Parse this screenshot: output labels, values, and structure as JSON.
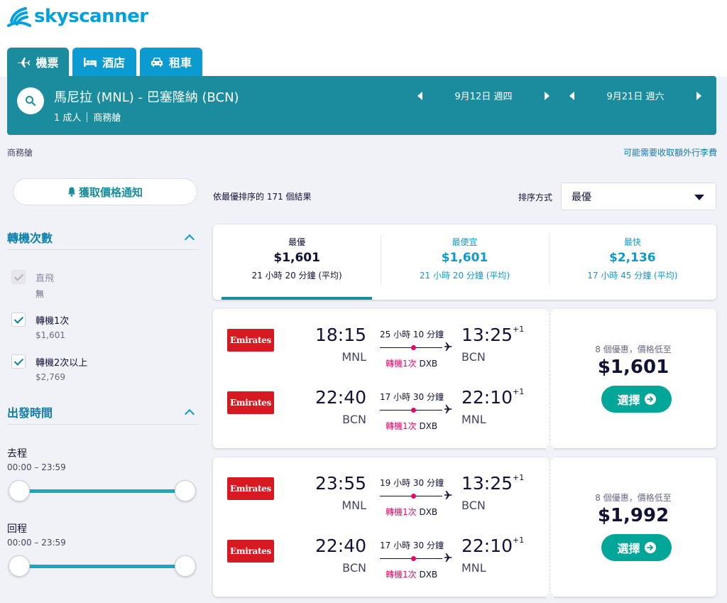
{
  "brand": {
    "name": "skyscanner"
  },
  "tabs": [
    {
      "label": "機票",
      "icon": "plane-icon"
    },
    {
      "label": "酒店",
      "icon": "bed-icon"
    },
    {
      "label": "租車",
      "icon": "car-icon"
    }
  ],
  "search": {
    "route": "馬尼拉 (MNL) - 巴塞隆納 (BCN)",
    "passengers": "1 成人",
    "cabin": "商務艙",
    "depart_date": "9月12日 週四",
    "return_date": "9月21日 週六"
  },
  "info": {
    "cabin_label": "商務艙",
    "baggage_note": "可能需要收取額外行李費"
  },
  "alert_button": "獲取價格通知",
  "filters": {
    "stops_title": "轉機次數",
    "stops": [
      {
        "label": "直飛",
        "sub": "無",
        "checked": true,
        "disabled": true
      },
      {
        "label": "轉機1次",
        "sub": "$1,601",
        "checked": true,
        "disabled": false
      },
      {
        "label": "轉機2次以上",
        "sub": "$2,769",
        "checked": true,
        "disabled": false
      }
    ],
    "times_title": "出發時間",
    "outbound_label": "去程",
    "outbound_range": "00:00 – 23:59",
    "return_label": "回程",
    "return_range": "00:00 – 23:59"
  },
  "results": {
    "count_text": "依最優排序的 171 個結果",
    "sort_label": "排序方式",
    "sort_value": "最優"
  },
  "sort_tabs": [
    {
      "title": "最優",
      "price": "$1,601",
      "duration": "21 小時 20 分鐘 (平均)"
    },
    {
      "title": "最便宜",
      "price": "$1,601",
      "duration": "21 小時 20 分鐘 (平均)"
    },
    {
      "title": "最快",
      "price": "$2,136",
      "duration": "17 小時 45 分鐘 (平均)"
    }
  ],
  "cards": [
    {
      "legs": [
        {
          "airline": "Emirates",
          "dep_time": "18:15",
          "dep_code": "MNL",
          "duration": "25 小時 10 分鐘",
          "stops": "轉機1次",
          "via": "DXB",
          "arr_time": "13:25",
          "day_offset": "+1",
          "arr_code": "BCN"
        },
        {
          "airline": "Emirates",
          "dep_time": "22:40",
          "dep_code": "BCN",
          "duration": "17 小時 30 分鐘",
          "stops": "轉機1次",
          "via": "DXB",
          "arr_time": "22:10",
          "day_offset": "+1",
          "arr_code": "MNL"
        }
      ],
      "deals": "8 個優惠，價格低至",
      "price": "$1,601",
      "select": "選擇"
    },
    {
      "legs": [
        {
          "airline": "Emirates",
          "dep_time": "23:55",
          "dep_code": "MNL",
          "duration": "19 小時 30 分鐘",
          "stops": "轉機1次",
          "via": "DXB",
          "arr_time": "13:25",
          "day_offset": "+1",
          "arr_code": "BCN"
        },
        {
          "airline": "Emirates",
          "dep_time": "22:40",
          "dep_code": "BCN",
          "duration": "17 小時 30 分鐘",
          "stops": "轉機1次",
          "via": "DXB",
          "arr_time": "22:10",
          "day_offset": "+1",
          "arr_code": "MNL"
        }
      ],
      "deals": "8 個優惠，價格低至",
      "price": "$1,992",
      "select": "選擇"
    }
  ],
  "colors": {
    "brand_blue": "#00a1de",
    "teal": "#1a8c9e",
    "select_green": "#00a698",
    "stop_red": "#e70866",
    "emirates_red": "#d71921"
  }
}
